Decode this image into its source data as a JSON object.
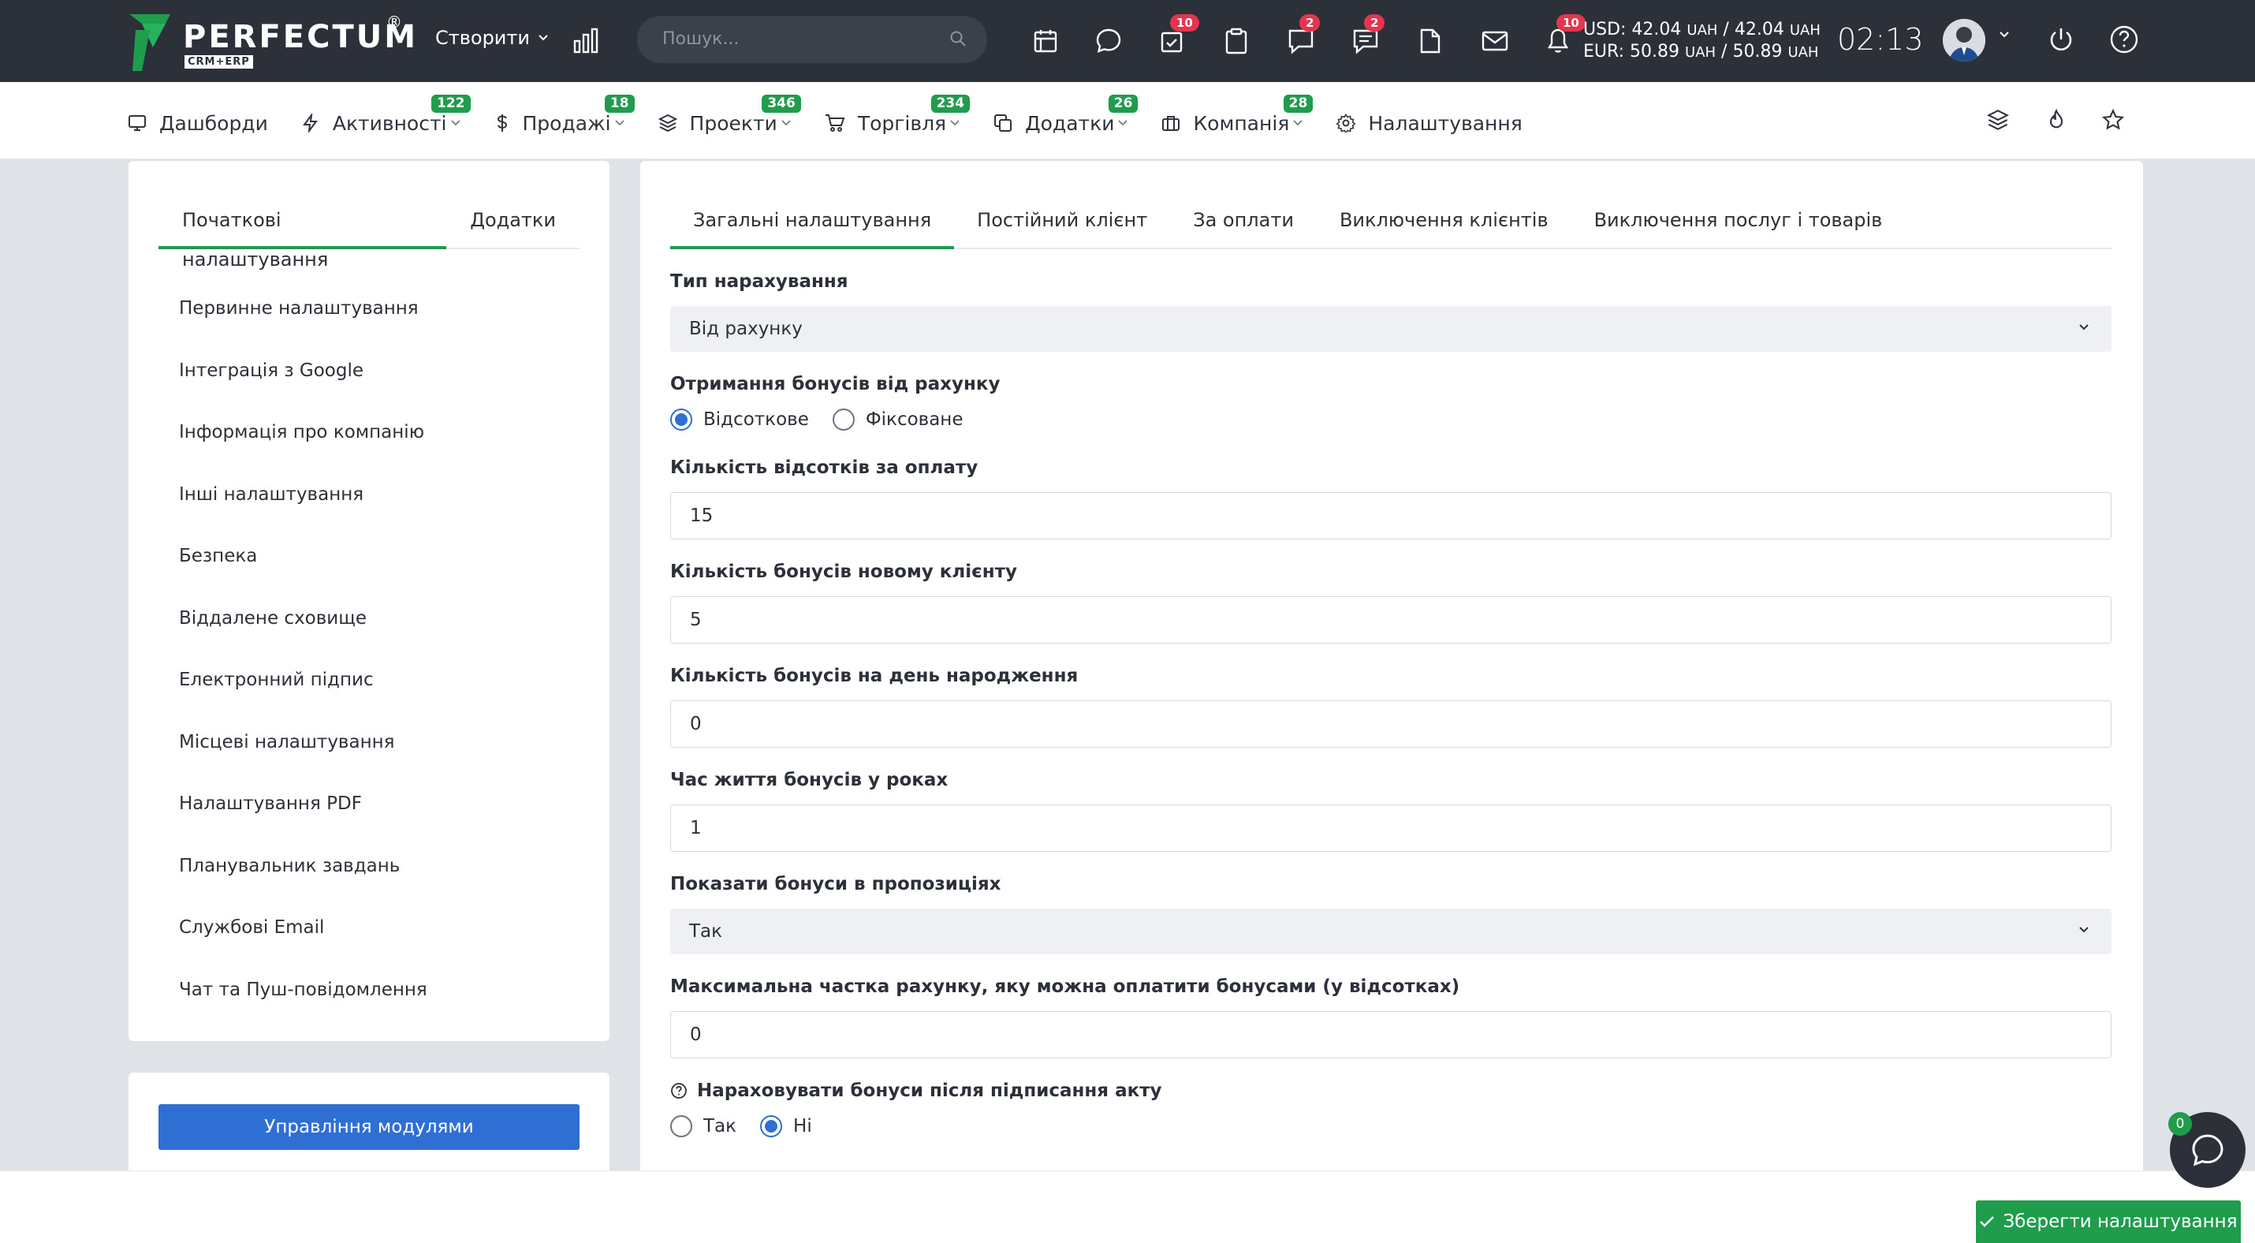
{
  "brand": {
    "name": "PERFECTUM",
    "reg": "®",
    "sub": "CRM+ERP",
    "accent": "#1f9d4c"
  },
  "topbar": {
    "create_label": "Створити",
    "search_placeholder": "Пошук...",
    "badges": {
      "tasks": "10",
      "chat2": "2",
      "messages": "2",
      "notifications": "10"
    },
    "currency": {
      "usd_label": "USD:",
      "usd_buy": "42.04",
      "usd_sell": "42.04",
      "eur_label": "EUR:",
      "eur_buy": "50.89",
      "eur_sell": "50.89",
      "unit": "UAH"
    },
    "time": "02:13"
  },
  "nav": {
    "items": [
      {
        "label": "Дашборди",
        "icon": "dashboard-icon",
        "badge": ""
      },
      {
        "label": "Активності",
        "icon": "activity-icon",
        "badge": "122"
      },
      {
        "label": "Продажі",
        "icon": "dollar-icon",
        "badge": "18"
      },
      {
        "label": "Проекти",
        "icon": "layers-icon",
        "badge": "346"
      },
      {
        "label": "Торгівля",
        "icon": "cart-icon",
        "badge": "234"
      },
      {
        "label": "Додатки",
        "icon": "copy-icon",
        "badge": "26"
      },
      {
        "label": "Компанія",
        "icon": "briefcase-icon",
        "badge": "28"
      },
      {
        "label": "Налаштування",
        "icon": "gear-icon",
        "badge": ""
      }
    ]
  },
  "left": {
    "tabs": [
      "Початкові налаштування",
      "Додатки"
    ],
    "menu": [
      "Первинне налаштування",
      "Інтеграція з Google",
      "Інформація про компанію",
      "Інші налаштування",
      "Безпека",
      "Віддалене сховище",
      "Електронний підпис",
      "Місцеві налаштування",
      "Налаштування PDF",
      "Планувальник завдань",
      "Службові Email",
      "Чат та Пуш-повідомлення"
    ],
    "modules_button": "Управління модулями"
  },
  "main": {
    "tabs": [
      "Загальні налаштування",
      "Постійний клієнт",
      "За оплати",
      "Виключення клієнтів",
      "Виключення послуг і товарів"
    ],
    "accrual_type": {
      "label": "Тип нарахування",
      "value": "Від рахунку"
    },
    "bonus_receive": {
      "label": "Отримання бонусів від рахунку",
      "options": [
        "Відсоткове",
        "Фіксоване"
      ],
      "selected": 0
    },
    "percent_per_payment": {
      "label": "Кількість відсотків за оплату",
      "value": "15"
    },
    "new_client_bonus": {
      "label": "Кількість бонусів новому клієнту",
      "value": "5"
    },
    "birthday_bonus": {
      "label": "Кількість бонусів на день народження",
      "value": "0"
    },
    "bonus_lifetime": {
      "label": "Час життя бонусів у роках",
      "value": "1"
    },
    "show_in_proposals": {
      "label": "Показати бонуси в пропозиціях",
      "value": "Так"
    },
    "max_share": {
      "label": "Максимальна частка рахунку, яку можна оплатити бонусами (у відсотках)",
      "value": "0"
    },
    "accrue_after_act": {
      "label": "Нараховувати бонуси після підписання акту",
      "options": [
        "Так",
        "Ні"
      ],
      "selected": 1
    }
  },
  "footer": {
    "save_button": "Зберегти налаштування",
    "chat_badge": "0"
  }
}
